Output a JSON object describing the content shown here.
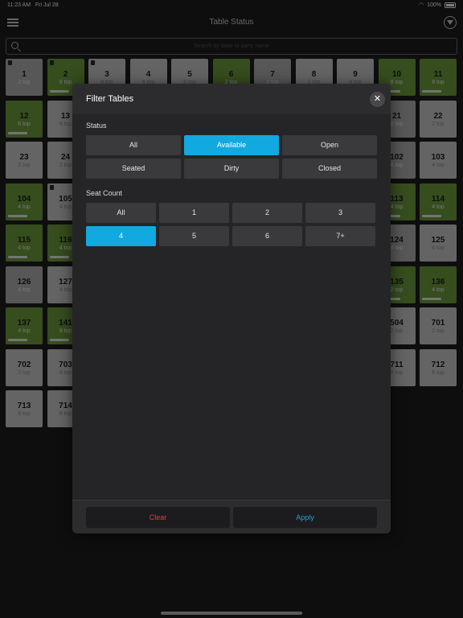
{
  "status_bar": {
    "time": "11:23 AM",
    "date": "Fri Jul 28",
    "battery": "100%"
  },
  "nav": {
    "title": "Table Status"
  },
  "search": {
    "placeholder": "Search by table or party name"
  },
  "tables": [
    {
      "num": "1",
      "cap": "2 top",
      "color": "gray",
      "trash": true
    },
    {
      "num": "2",
      "cap": "8 top",
      "color": "green",
      "trash": true,
      "bar": true
    },
    {
      "num": "3",
      "cap": "8 top",
      "color": "light",
      "trash": true
    },
    {
      "num": "4",
      "cap": "6 top",
      "color": "light"
    },
    {
      "num": "5",
      "cap": "8 top",
      "color": "light"
    },
    {
      "num": "6",
      "cap": "2 top",
      "color": "green"
    },
    {
      "num": "7",
      "cap": "2 top",
      "color": "gray"
    },
    {
      "num": "8",
      "cap": "2 top",
      "color": "light"
    },
    {
      "num": "9",
      "cap": "8 top",
      "color": "light"
    },
    {
      "num": "10",
      "cap": "8 top",
      "color": "green",
      "bar": true
    },
    {
      "num": "11",
      "cap": "8 top",
      "color": "green",
      "bar": true
    },
    {
      "num": "12",
      "cap": "6 top",
      "color": "green",
      "bar": true
    },
    {
      "num": "13",
      "cap": "6 top",
      "color": "light"
    },
    {
      "num": "",
      "cap": "",
      "color": "light"
    },
    {
      "num": "",
      "cap": "",
      "color": "light"
    },
    {
      "num": "",
      "cap": "",
      "color": "light"
    },
    {
      "num": "",
      "cap": "",
      "color": "light"
    },
    {
      "num": "",
      "cap": "",
      "color": "light"
    },
    {
      "num": "",
      "cap": "",
      "color": "light"
    },
    {
      "num": "",
      "cap": "",
      "color": "light"
    },
    {
      "num": "21",
      "cap": "2 top",
      "color": "gray"
    },
    {
      "num": "22",
      "cap": "2 top",
      "color": "light"
    },
    {
      "num": "23",
      "cap": "2 top",
      "color": "light"
    },
    {
      "num": "24",
      "cap": "2 top",
      "color": "light"
    },
    {
      "num": "",
      "cap": "",
      "color": "light"
    },
    {
      "num": "",
      "cap": "",
      "color": "light"
    },
    {
      "num": "",
      "cap": "",
      "color": "light"
    },
    {
      "num": "",
      "cap": "",
      "color": "light"
    },
    {
      "num": "",
      "cap": "",
      "color": "light"
    },
    {
      "num": "",
      "cap": "",
      "color": "light"
    },
    {
      "num": "",
      "cap": "",
      "color": "light"
    },
    {
      "num": "102",
      "cap": "4 top",
      "color": "gray"
    },
    {
      "num": "103",
      "cap": "4 top",
      "color": "light"
    },
    {
      "num": "104",
      "cap": "4 top",
      "color": "green",
      "bar": true
    },
    {
      "num": "105",
      "cap": "4 top",
      "color": "light",
      "trash": true
    },
    {
      "num": "",
      "cap": "",
      "color": "light"
    },
    {
      "num": "",
      "cap": "",
      "color": "light"
    },
    {
      "num": "",
      "cap": "",
      "color": "light"
    },
    {
      "num": "",
      "cap": "",
      "color": "light"
    },
    {
      "num": "",
      "cap": "",
      "color": "light"
    },
    {
      "num": "",
      "cap": "",
      "color": "light"
    },
    {
      "num": "",
      "cap": "",
      "color": "light"
    },
    {
      "num": "113",
      "cap": "4 top",
      "color": "green",
      "bar": true
    },
    {
      "num": "114",
      "cap": "4 top",
      "color": "green",
      "bar": true
    },
    {
      "num": "115",
      "cap": "4 top",
      "color": "green",
      "bar": true
    },
    {
      "num": "116",
      "cap": "4 top",
      "color": "green",
      "bar": true
    },
    {
      "num": "",
      "cap": "",
      "color": "light"
    },
    {
      "num": "",
      "cap": "",
      "color": "light"
    },
    {
      "num": "",
      "cap": "",
      "color": "light"
    },
    {
      "num": "",
      "cap": "",
      "color": "light"
    },
    {
      "num": "",
      "cap": "",
      "color": "light"
    },
    {
      "num": "",
      "cap": "",
      "color": "light"
    },
    {
      "num": "",
      "cap": "",
      "color": "light"
    },
    {
      "num": "124",
      "cap": "4 top",
      "color": "gray"
    },
    {
      "num": "125",
      "cap": "4 top",
      "color": "light"
    },
    {
      "num": "126",
      "cap": "4 top",
      "color": "gray"
    },
    {
      "num": "127",
      "cap": "4 top",
      "color": "light"
    },
    {
      "num": "",
      "cap": "",
      "color": "light"
    },
    {
      "num": "",
      "cap": "",
      "color": "light"
    },
    {
      "num": "",
      "cap": "",
      "color": "light"
    },
    {
      "num": "",
      "cap": "",
      "color": "light"
    },
    {
      "num": "",
      "cap": "",
      "color": "light"
    },
    {
      "num": "",
      "cap": "",
      "color": "light"
    },
    {
      "num": "",
      "cap": "",
      "color": "light"
    },
    {
      "num": "135",
      "cap": "2 top",
      "color": "green",
      "bar": true
    },
    {
      "num": "136",
      "cap": "4 top",
      "color": "green",
      "bar": true
    },
    {
      "num": "137",
      "cap": "4 top",
      "color": "green",
      "bar": true
    },
    {
      "num": "141",
      "cap": "8 top",
      "color": "green",
      "bar": true
    },
    {
      "num": "",
      "cap": "",
      "color": "light"
    },
    {
      "num": "",
      "cap": "",
      "color": "light"
    },
    {
      "num": "",
      "cap": "",
      "color": "light"
    },
    {
      "num": "",
      "cap": "",
      "color": "light"
    },
    {
      "num": "",
      "cap": "",
      "color": "light"
    },
    {
      "num": "",
      "cap": "",
      "color": "light"
    },
    {
      "num": "",
      "cap": "",
      "color": "light"
    },
    {
      "num": "504",
      "cap": "2 top",
      "color": "light"
    },
    {
      "num": "701",
      "cap": "2 top",
      "color": "light"
    },
    {
      "num": "702",
      "cap": "2 top",
      "color": "light"
    },
    {
      "num": "703",
      "cap": "4 top",
      "color": "light"
    },
    {
      "num": "",
      "cap": "",
      "color": "light"
    },
    {
      "num": "",
      "cap": "",
      "color": "light"
    },
    {
      "num": "",
      "cap": "",
      "color": "light"
    },
    {
      "num": "",
      "cap": "",
      "color": "light"
    },
    {
      "num": "",
      "cap": "",
      "color": "light"
    },
    {
      "num": "",
      "cap": "",
      "color": "light"
    },
    {
      "num": "",
      "cap": "",
      "color": "light"
    },
    {
      "num": "711",
      "cap": "8 top",
      "color": "light"
    },
    {
      "num": "712",
      "cap": "8 top",
      "color": "light"
    },
    {
      "num": "713",
      "cap": "8 top",
      "color": "light"
    },
    {
      "num": "714",
      "cap": "8 top",
      "color": "light"
    }
  ],
  "modal": {
    "title": "Filter Tables",
    "status_label": "Status",
    "status_options": [
      "All",
      "Available",
      "Open",
      "Seated",
      "Dirty",
      "Closed"
    ],
    "status_selected": "Available",
    "seat_label": "Seat Count",
    "seat_options": [
      "All",
      "1",
      "2",
      "3",
      "4",
      "5",
      "6",
      "7+"
    ],
    "seat_selected": "4",
    "clear_label": "Clear",
    "apply_label": "Apply"
  },
  "colors": {
    "accent": "#12a8e0",
    "available_green": "#6c9a3c",
    "clear_red": "#e0413a",
    "apply_blue": "#1aa6dc"
  }
}
